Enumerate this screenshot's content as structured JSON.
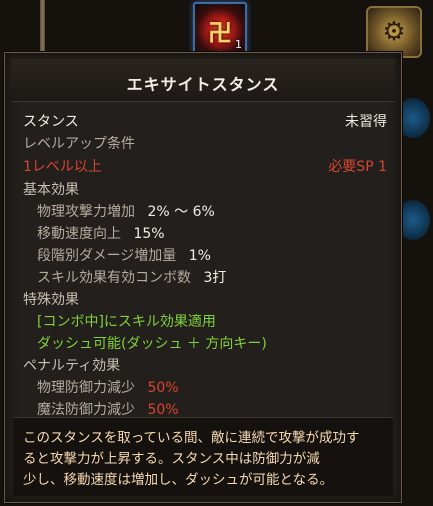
{
  "background": {
    "skill_slot": {
      "glyph": "卍",
      "count": "1"
    },
    "corner_button": {
      "glyph": "⚙"
    }
  },
  "tooltip": {
    "title": "エキサイトスタンス",
    "type_label": "スタンス",
    "status": "未習得",
    "levelup_header": "レベルアップ条件",
    "level_req": "1レベル以上",
    "sp_req": "必要SP 1",
    "basic_effects": {
      "header": "基本効果",
      "items": [
        {
          "label": "物理攻撃力増加",
          "value": "2% ～ 6%"
        },
        {
          "label": "移動速度向上",
          "value": "15%"
        },
        {
          "label": "段階別ダメージ増加量",
          "value": "1%"
        },
        {
          "label": "スキル効果有効コンボ数",
          "value": "3打"
        }
      ]
    },
    "special_effects": {
      "header": "特殊効果",
      "items": [
        "[コンボ中]にスキル効果適用",
        "ダッシュ可能(ダッシュ ＋ 方向キー)"
      ]
    },
    "penalty_effects": {
      "header": "ペナルティ効果",
      "items": [
        {
          "label": "物理防御力減少",
          "value": "50%"
        },
        {
          "label": "魔法防御力減少",
          "value": "50%"
        }
      ]
    },
    "description_lines": [
      "このスタンスを取っている間、敵に連続で攻撃が成功す",
      "ると攻撃力が上昇する。スタンス中は防御力が減",
      "少し、移動速度は増加し、ダッシュが可能となる。"
    ]
  },
  "colors": {
    "title": "#f3efe6",
    "requirement_red": "#d8452f",
    "special_green": "#7fd23a",
    "description": "#f6d9b0"
  }
}
